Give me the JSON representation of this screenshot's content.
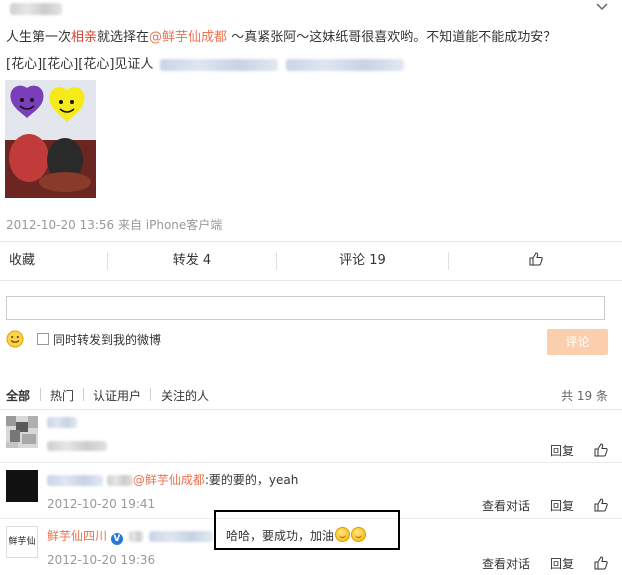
{
  "post": {
    "line1_a": "人生第一次",
    "line1_link": "相亲",
    "line1_b": "就选择在",
    "line1_mention": "@鲜芋仙成都",
    "line1_c": " ～真紧张阿～这妹纸哥很喜欢哟。不知道能不能成功安？",
    "line2": "[花心][花心][花心]见证人",
    "meta": "2012-10-20 13:56 来自 iPhone客户端"
  },
  "actions": {
    "favorite": "收藏",
    "repost": "转发 4",
    "comment": "评论 19"
  },
  "composer": {
    "repost_label": "同时转发到我的微博",
    "submit_label": "评论"
  },
  "filters": {
    "all": "全部",
    "hot": "热门",
    "verified": "认证用户",
    "following": "关注的人",
    "total": "共 19 条"
  },
  "comments": [
    {
      "text": "",
      "time": "",
      "reply": "回复"
    },
    {
      "mention": "@鲜芋仙成都",
      "text": ":要的要的，yeah",
      "time": "2012-10-20 19:41",
      "view_convo": "查看对话",
      "reply": "回复"
    },
    {
      "author": "鲜芋仙四川",
      "text": "哈哈，要成功，加油",
      "time": "2012-10-20 19:36",
      "view_convo": "查看对话",
      "reply": "回复",
      "avatar_text": "鲜芋仙"
    }
  ],
  "colors": {
    "link_red": "#d2452c",
    "mention_orange": "#eb7350",
    "submit_disabled": "#fbcfae",
    "highlight_border": "#000000"
  }
}
